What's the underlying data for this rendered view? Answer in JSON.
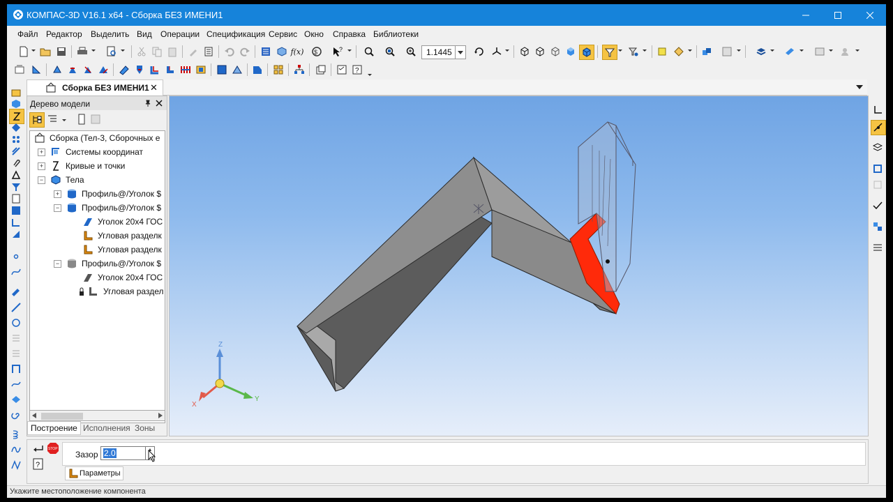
{
  "window": {
    "title": "КОМПАС-3D V16.1 x64 - Сборка БЕЗ ИМЕНИ1",
    "colors": {
      "titlebar": "#1683da",
      "highlight": "#f5c343",
      "selection": "#3079d6"
    }
  },
  "menu": [
    "Файл",
    "Редактор",
    "Выделить",
    "Вид",
    "Операции",
    "Спецификация",
    "Сервис",
    "Окно",
    "Справка",
    "Библиотеки"
  ],
  "toolbar": {
    "zoom_value": "1.1445"
  },
  "document_tab": {
    "label": "Сборка БЕЗ ИМЕНИ1",
    "close": "✕"
  },
  "model_tree": {
    "header": "Дерево модели",
    "items": [
      {
        "label": "Сборка (Тел-3, Сборочных е",
        "icon": "assembly-icon"
      },
      {
        "label": "Системы координат",
        "icon": "coordinate-systems-icon"
      },
      {
        "label": "Кривые и точки",
        "icon": "curves-icon"
      },
      {
        "label": "Тела",
        "icon": "bodies-icon"
      },
      {
        "label": "Профиль@/Уголок $",
        "icon": "profile-blue-icon"
      },
      {
        "label": "Профиль@/Уголок $",
        "icon": "profile-blue-icon"
      },
      {
        "label": "Уголок 20х4 ГОС",
        "icon": "angle-profile-icon"
      },
      {
        "label": "Угловая разделк",
        "icon": "corner-cut-icon"
      },
      {
        "label": "Угловая разделк",
        "icon": "corner-cut-icon"
      },
      {
        "label": "Профиль@/Уголок $",
        "icon": "profile-gray-icon"
      },
      {
        "label": "Уголок 20х4 ГОС",
        "icon": "angle-profile-gray-icon"
      },
      {
        "label": "Угловая раздел",
        "icon": "corner-cut-gray-icon"
      }
    ],
    "tabs": [
      "Построение",
      "Исполнения",
      "Зоны"
    ]
  },
  "viewport": {
    "axes": {
      "x": "X",
      "y": "Y",
      "z": "Z"
    },
    "colors": {
      "part": "#9a9a9a",
      "highlight_face": "#ff2a0a",
      "ghost": "#aabbd2"
    }
  },
  "properties": {
    "gap_label": "Зазор",
    "gap_value": "2.0",
    "tab_label": "Параметры",
    "stop_label": "STOP"
  },
  "status": {
    "text": "Укажите местоположение компонента"
  }
}
